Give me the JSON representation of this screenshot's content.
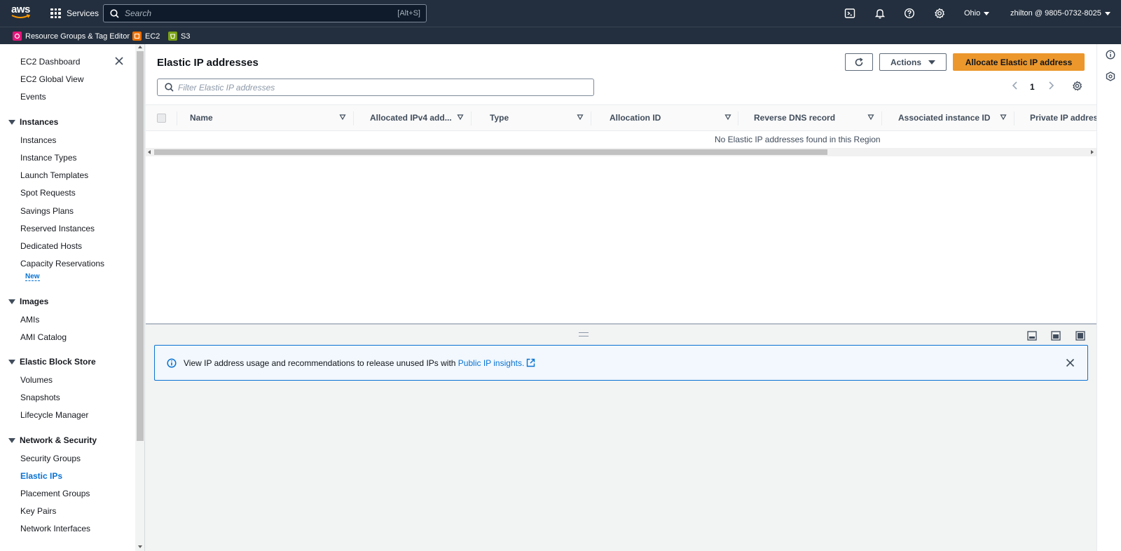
{
  "topnav": {
    "logo_text": "aws",
    "services_label": "Services",
    "search_placeholder": "Search",
    "search_shortcut": "[Alt+S]",
    "region_label": "Ohio",
    "account_label": "zhilton @ 9805-0732-8025"
  },
  "favorites": [
    {
      "label": "Resource Groups & Tag Editor",
      "color": "#e7157b"
    },
    {
      "label": "EC2",
      "color": "#ed7100"
    },
    {
      "label": "S3",
      "color": "#7aa116"
    }
  ],
  "sidebar": {
    "top_items": [
      "EC2 Dashboard",
      "EC2 Global View",
      "Events"
    ],
    "sections": [
      {
        "title": "Instances",
        "items": [
          "Instances",
          "Instance Types",
          "Launch Templates",
          "Spot Requests",
          "Savings Plans",
          "Reserved Instances",
          "Dedicated Hosts",
          "Capacity Reservations"
        ],
        "new_badge": "New"
      },
      {
        "title": "Images",
        "items": [
          "AMIs",
          "AMI Catalog"
        ]
      },
      {
        "title": "Elastic Block Store",
        "items": [
          "Volumes",
          "Snapshots",
          "Lifecycle Manager"
        ]
      },
      {
        "title": "Network & Security",
        "items": [
          "Security Groups",
          "Elastic IPs",
          "Placement Groups",
          "Key Pairs",
          "Network Interfaces"
        ]
      }
    ],
    "active_item": "Elastic IPs"
  },
  "main": {
    "title": "Elastic IP addresses",
    "actions_label": "Actions",
    "primary_button": "Allocate Elastic IP address",
    "filter_placeholder": "Filter Elastic IP addresses",
    "page_number": "1",
    "columns": [
      "Name",
      "Allocated IPv4 add...",
      "Type",
      "Allocation ID",
      "Reverse DNS record",
      "Associated instance ID",
      "Private IP addres"
    ],
    "empty_message": "No Elastic IP addresses found in this Region"
  },
  "split_panel": {
    "banner_text": "View IP address usage and recommendations to release unused IPs with ",
    "banner_link": "Public IP insights."
  },
  "colors": {
    "nav_bg": "#232f3e",
    "primary_button": "#ec972c",
    "link": "#0972d3"
  }
}
